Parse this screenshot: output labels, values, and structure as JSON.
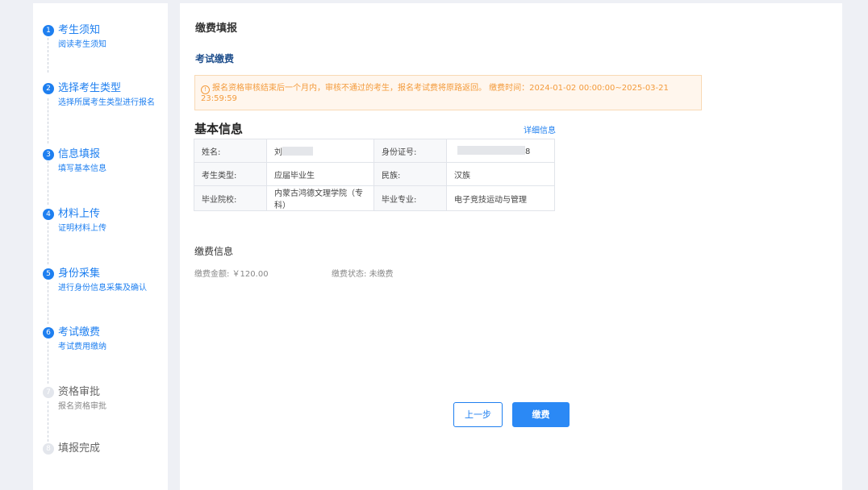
{
  "steps": [
    {
      "num": "1",
      "title": "考生须知",
      "desc": "阅读考生须知",
      "state": "done"
    },
    {
      "num": "2",
      "title": "选择考生类型",
      "desc": "选择所属考生类型进行报名",
      "state": "done"
    },
    {
      "num": "3",
      "title": "信息填报",
      "desc": "填写基本信息",
      "state": "done"
    },
    {
      "num": "4",
      "title": "材料上传",
      "desc": "证明材料上传",
      "state": "done"
    },
    {
      "num": "5",
      "title": "身份采集",
      "desc": "进行身份信息采集及确认",
      "state": "done"
    },
    {
      "num": "6",
      "title": "考试缴费",
      "desc": "考试费用缴纳",
      "state": "active"
    },
    {
      "num": "7",
      "title": "资格审批",
      "desc": "报名资格审批",
      "state": "pending"
    },
    {
      "num": "8",
      "title": "填报完成",
      "desc": "",
      "state": "pending"
    }
  ],
  "main": {
    "page_title": "缴费填报",
    "section_title": "考试缴费",
    "notice_line1": "报名资格审核结束后一个月内，审核不通过的考生，报名考试费将原路返回。 缴费时间：2024-01-02 00:00:00~2025-03-21",
    "notice_line2": "23:59:59",
    "basic_title": "基本信息",
    "detail_link": "详细信息",
    "table": {
      "name_label": "姓名:",
      "name_value": "刘",
      "id_label": "身份证号:",
      "id_value": "8",
      "type_label": "考生类型:",
      "type_value": "应届毕业生",
      "nation_label": "民族:",
      "nation_value": "汉族",
      "school_label": "毕业院校:",
      "school_value": "内蒙古鸿德文理学院（专科）",
      "major_label": "毕业专业:",
      "major_value": "电子竞技运动与管理"
    },
    "fee_title": "缴费信息",
    "fee_amount_label": "缴费金额:",
    "fee_amount_value": "￥120.00",
    "fee_status_label": "缴费状态:",
    "fee_status_value": "未缴费",
    "prev_button": "上一步",
    "pay_button": "缴费"
  },
  "colors": {
    "accent": "#1e7ff0",
    "notice_text": "#f39b3c",
    "notice_bg": "#fff6ed"
  }
}
